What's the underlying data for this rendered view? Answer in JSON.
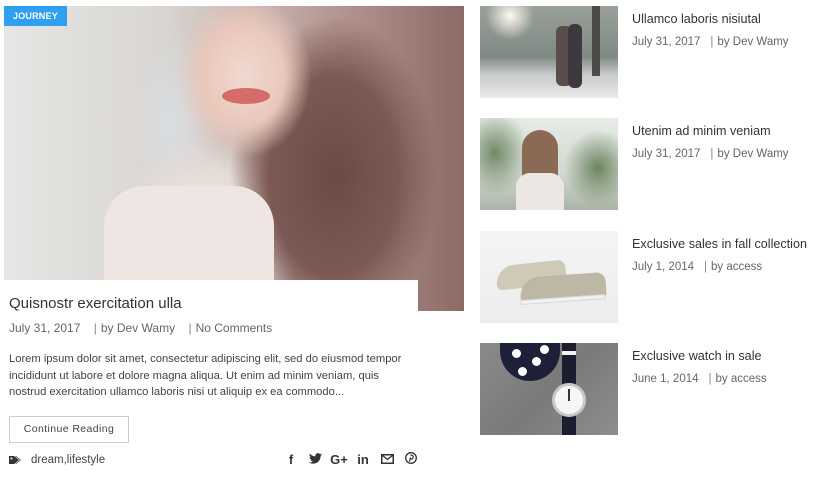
{
  "featured": {
    "category": "JOURNEY",
    "title": "Quisnostr exercitation ulla",
    "date": "July 31, 2017",
    "author": "by Dev Wamy",
    "comments": "No Comments",
    "separator": "|",
    "excerpt": "Lorem ipsum dolor sit amet, consectetur adipiscing elit, sed do eiusmod tempor incididunt ut labore et dolore magna aliqua. Ut enim ad minim veniam, quis nostrud exercitation ullamco laboris nisi ut aliquip ex ea commodo...",
    "button_label": "Continue Reading",
    "tags": "dream,lifestyle",
    "tag_icon": "tag-icon",
    "share_icons": [
      {
        "name": "facebook-icon",
        "glyph": "f"
      },
      {
        "name": "twitter-icon",
        "glyph": "🐦"
      },
      {
        "name": "google-plus-icon",
        "glyph": "G+"
      },
      {
        "name": "linkedin-icon",
        "glyph": "in"
      },
      {
        "name": "email-icon",
        "glyph": "✉"
      },
      {
        "name": "pinterest-icon",
        "glyph": "℗"
      }
    ]
  },
  "side_posts": [
    {
      "title": "Ullamco laboris nisiutal",
      "date": "July 31, 2017",
      "author": "by Dev Wamy"
    },
    {
      "title": "Utenim ad minim veniam",
      "date": "July 31, 2017",
      "author": "by Dev Wamy"
    },
    {
      "title": "Exclusive sales in fall collection",
      "date": "July 1, 2014",
      "author": "by access"
    },
    {
      "title": "Exclusive watch in sale",
      "date": "June 1, 2014",
      "author": "by access"
    }
  ],
  "colors": {
    "accent": "#2f9ff0",
    "text": "#333333",
    "meta": "#666666"
  }
}
